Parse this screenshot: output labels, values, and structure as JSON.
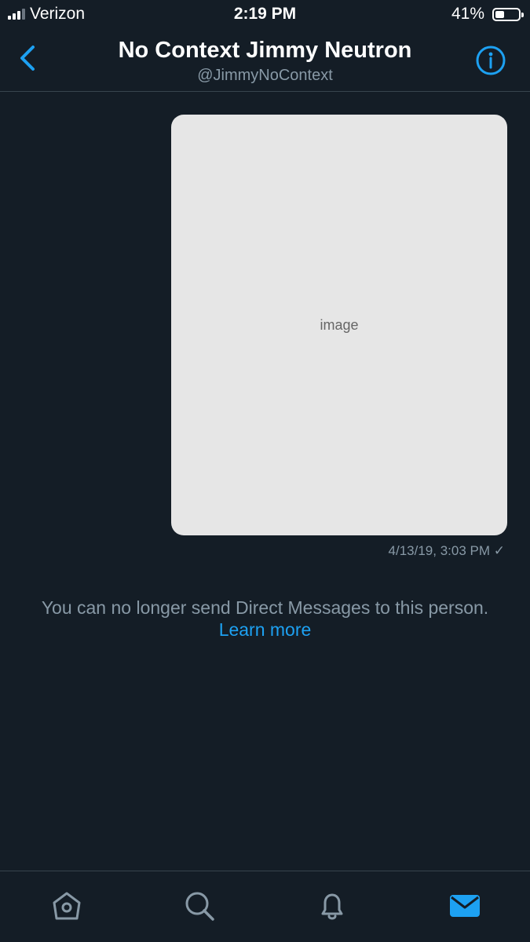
{
  "status_bar": {
    "carrier": "Verizon",
    "time": "2:19 PM",
    "battery_percent": "41%",
    "battery_level": 0.41
  },
  "header": {
    "title": "No Context Jimmy Neutron",
    "handle": "@JimmyNoContext",
    "back_icon": "chevron-left-icon",
    "info_icon": "info-icon"
  },
  "message": {
    "timestamp": "4/13/19, 3:03 PM ✓"
  },
  "footer_notice": {
    "text": "You can no longer send Direct Messages to this person.",
    "link": "Learn more"
  },
  "tab_bar": {
    "items": [
      "home-icon",
      "search-icon",
      "notifications-icon",
      "messages-icon"
    ]
  },
  "colors": {
    "background": "#141d26",
    "accent": "#1da1f2",
    "muted": "#8899a6"
  }
}
